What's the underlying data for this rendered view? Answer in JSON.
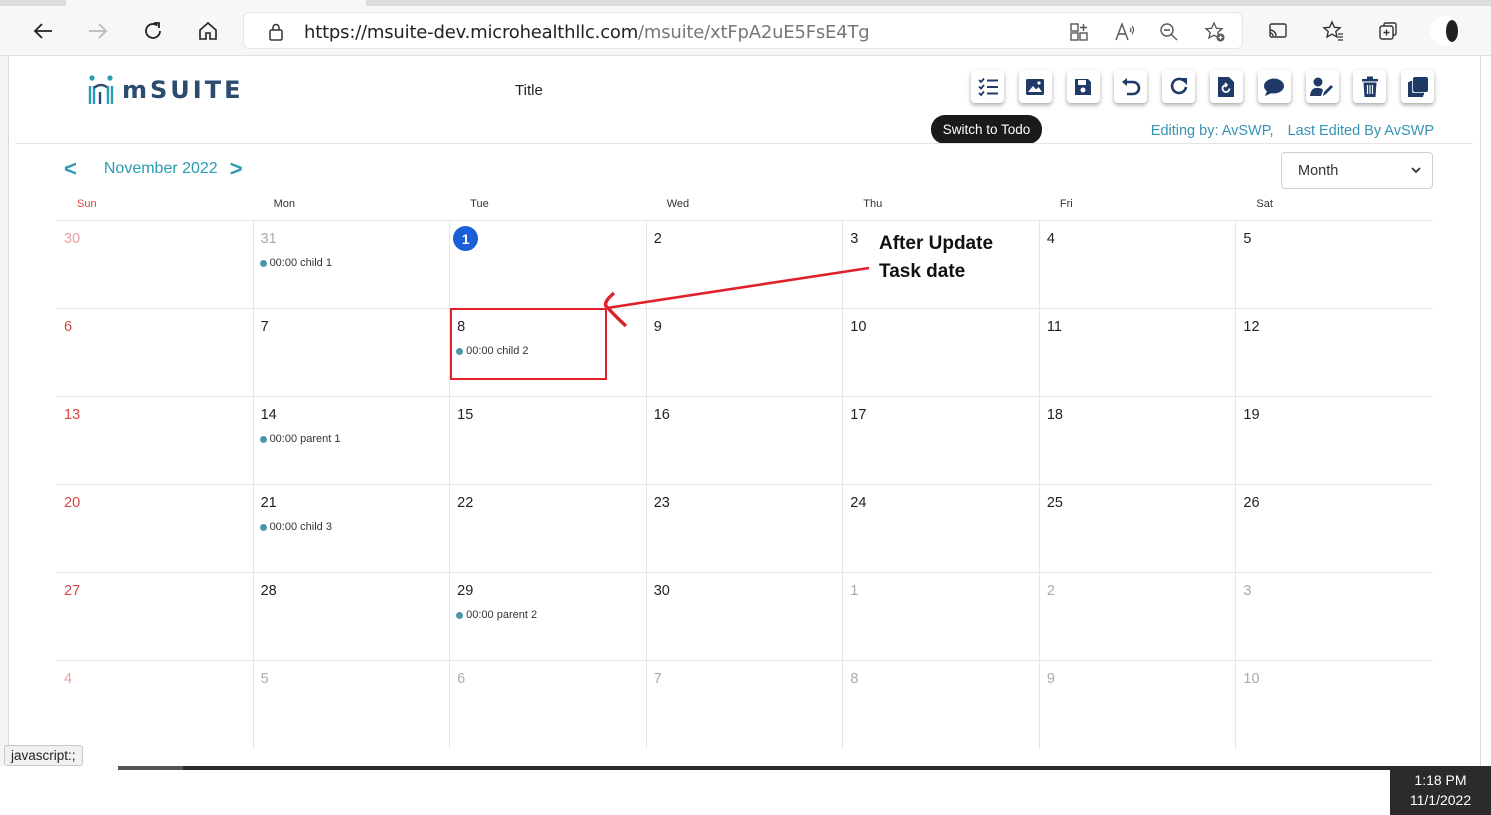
{
  "browser": {
    "url_host": "https://msuite-dev.microhealthllc.com",
    "url_path": "/msuite/xtFpA2uE5FsE4Tg",
    "icons": [
      "back-icon",
      "forward-icon",
      "refresh-icon",
      "home-icon",
      "lock-icon",
      "apps-icon",
      "read-aloud-icon",
      "zoom-out-icon",
      "add-favorite-icon",
      "cast-icon",
      "favorites-icon",
      "collections-icon"
    ]
  },
  "app": {
    "logo_text": "mSUITE",
    "title": "Title",
    "tooltip": "Switch to Todo",
    "editing_by": "Editing by: AvSWP,",
    "last_edited": "Last Edited By AvSWP",
    "toolbar_icons": [
      "todo-list-icon",
      "image-icon",
      "save-icon",
      "undo-icon",
      "redo-icon",
      "history-icon",
      "comment-icon",
      "user-edit-icon",
      "trash-icon",
      "duplicate-icon"
    ],
    "brand_color": "#2a9bb4",
    "toolbar_color": "#1f3a66"
  },
  "calendar": {
    "prev": "<",
    "next": ">",
    "month_label": "November 2022",
    "view": "Month",
    "weekdays": [
      "Sun",
      "Mon",
      "Tue",
      "Wed",
      "Thu",
      "Fri",
      "Sat"
    ],
    "days": [
      {
        "n": "30",
        "other": true
      },
      {
        "n": "31",
        "other": true,
        "event": "00:00 child 1"
      },
      {
        "n": "1",
        "today": true
      },
      {
        "n": "2"
      },
      {
        "n": "3"
      },
      {
        "n": "4"
      },
      {
        "n": "5"
      },
      {
        "n": "6"
      },
      {
        "n": "7"
      },
      {
        "n": "8",
        "event": "00:00 child 2"
      },
      {
        "n": "9"
      },
      {
        "n": "10"
      },
      {
        "n": "11"
      },
      {
        "n": "12"
      },
      {
        "n": "13"
      },
      {
        "n": "14",
        "event": "00:00 parent 1"
      },
      {
        "n": "15"
      },
      {
        "n": "16"
      },
      {
        "n": "17"
      },
      {
        "n": "18"
      },
      {
        "n": "19"
      },
      {
        "n": "20"
      },
      {
        "n": "21",
        "event": "00:00 child 3"
      },
      {
        "n": "22"
      },
      {
        "n": "23"
      },
      {
        "n": "24"
      },
      {
        "n": "25"
      },
      {
        "n": "26"
      },
      {
        "n": "27"
      },
      {
        "n": "28"
      },
      {
        "n": "29",
        "event": "00:00 parent 2"
      },
      {
        "n": "30"
      },
      {
        "n": "1",
        "other": true
      },
      {
        "n": "2",
        "other": true
      },
      {
        "n": "3",
        "other": true
      },
      {
        "n": "4",
        "other": true
      },
      {
        "n": "5",
        "other": true
      },
      {
        "n": "6",
        "other": true
      },
      {
        "n": "7",
        "other": true
      },
      {
        "n": "8",
        "other": true
      },
      {
        "n": "9",
        "other": true
      },
      {
        "n": "10",
        "other": true
      }
    ]
  },
  "annotation": {
    "line1": "After Update",
    "line2": "Task date",
    "color": "#e0202a"
  },
  "status": {
    "link": "javascript:;",
    "time": "1:18 PM",
    "date": "11/1/2022"
  }
}
